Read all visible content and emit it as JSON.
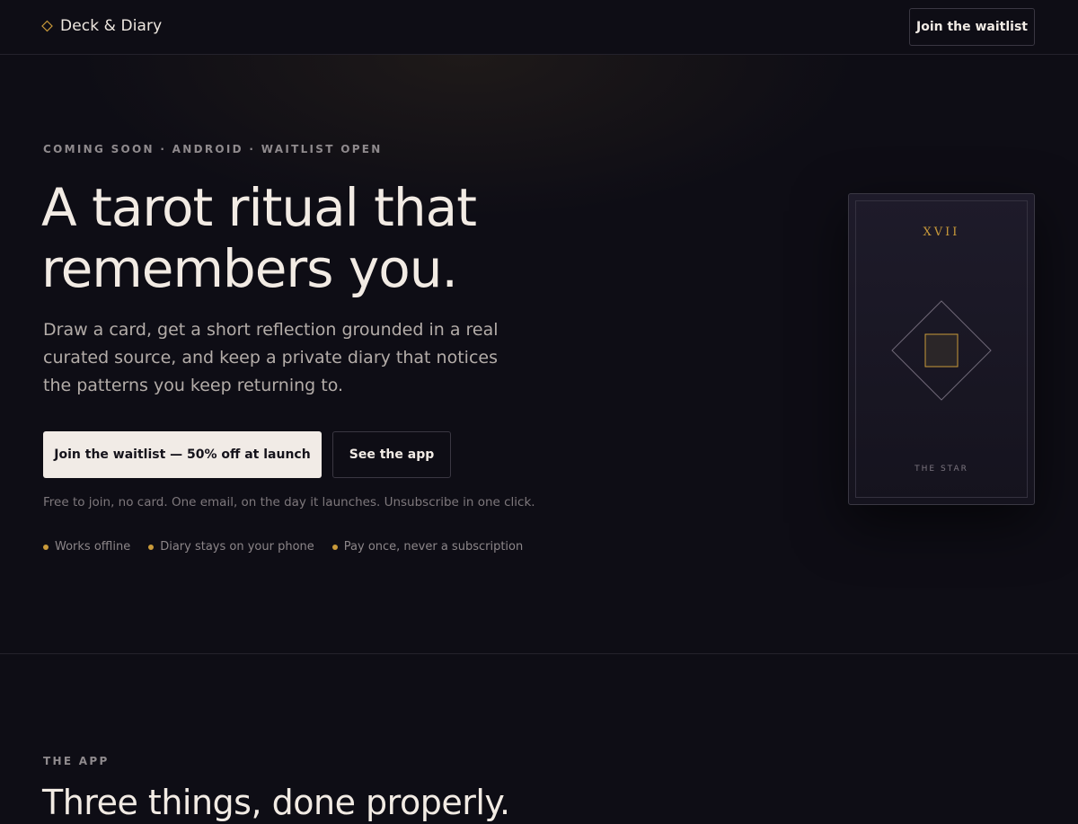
{
  "nav": {
    "brand_name": "Deck & Diary",
    "cta_label": "Join the waitlist"
  },
  "hero": {
    "eyebrow": "COMING SOON · ANDROID · WAITLIST OPEN",
    "headline": "A tarot ritual that remembers you.",
    "lede": "Draw a card, get a short reflection grounded in a real curated source, and keep a private diary that notices the patterns you keep returning to.",
    "primary_cta": "Join the waitlist — 50% off at launch",
    "secondary_cta": "See the app",
    "fineprint": "Free to join, no card. One email, on the day it launches. Unsubscribe in one click.",
    "features": [
      "Works offline",
      "Diary stays on your phone",
      "Pay once, never a subscription"
    ]
  },
  "card": {
    "numeral": "XVII",
    "name": "THE STAR"
  },
  "app_section": {
    "eyebrow": "THE APP",
    "title": "Three things, done properly."
  },
  "colors": {
    "background": "#0e0d15",
    "accent_gold": "#c99a3a",
    "text_primary": "#f2ebe4",
    "button_light": "#f1ebe6"
  },
  "icons": {
    "brand": "diamond-outline-icon",
    "card_art": "diamond-with-square-icon",
    "feature_bullet": "gold-dot-icon"
  }
}
